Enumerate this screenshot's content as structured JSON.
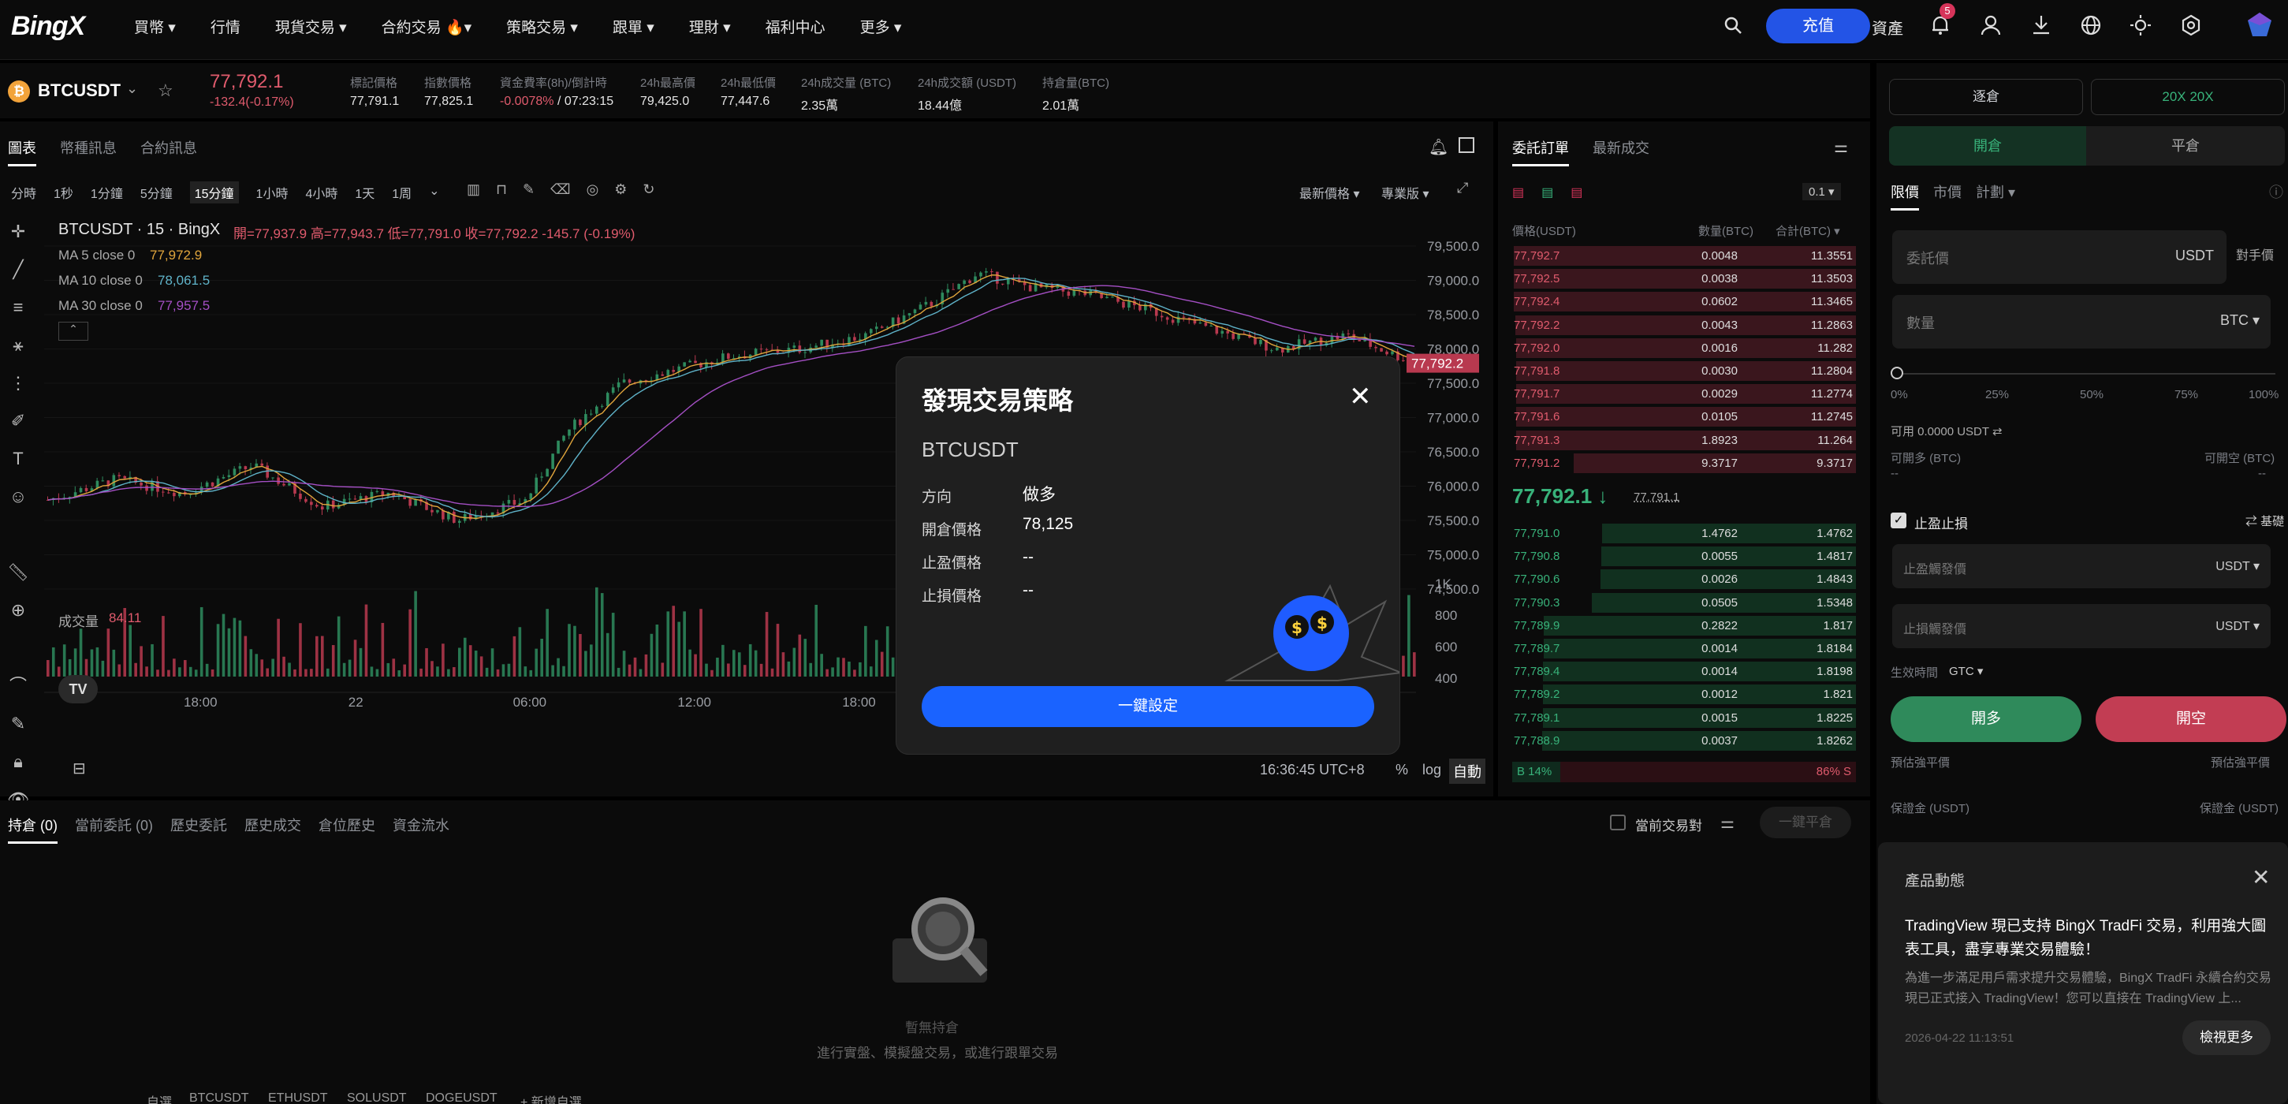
{
  "nav": {
    "logo": "BingX",
    "items": [
      "買幣 ▾",
      "行情",
      "現貨交易 ▾",
      "合約交易 🔥▾",
      "策略交易 ▾",
      "跟單 ▾",
      "理財 ▾",
      "福利中心",
      "更多 ▾"
    ],
    "deposit": "充值",
    "assets": "資產",
    "badge": "5"
  },
  "ticker": {
    "symbol": "BTCUSDT",
    "price": "77,792.1",
    "change": "-132.4(-0.17%)",
    "stats": [
      {
        "label": "標記價格",
        "value": "77,791.1"
      },
      {
        "label": "指數價格",
        "value": "77,825.1"
      },
      {
        "label": "資金費率(8h)/倒計時",
        "value": "-0.0078%",
        "value2": " / 07:23:15"
      },
      {
        "label": "24h最高價",
        "value": "79,425.0"
      },
      {
        "label": "24h最低價",
        "value": "77,447.6"
      },
      {
        "label": "24h成交量 (BTC)",
        "value": "2.35萬"
      },
      {
        "label": "24h成交額 (USDT)",
        "value": "18.44億"
      },
      {
        "label": "持倉量(BTC)",
        "value": "2.01萬"
      }
    ]
  },
  "chart_tabs": [
    "圖表",
    "幣種訊息",
    "合約訊息"
  ],
  "timeframes": [
    "分時",
    "1秒",
    "1分鐘",
    "5分鐘",
    "15分鐘",
    "1小時",
    "4小時",
    "1天",
    "1周"
  ],
  "chart_opts": {
    "price_type": "最新價格 ▾",
    "mode": "專業版 ▾"
  },
  "chart": {
    "title": "BTCUSDT · 15 · BingX",
    "ohlc": "開=77,937.9 高=77,943.7 低=77,791.0 收=77,792.2 -145.7 (-0.19%)",
    "ma": [
      {
        "label": "MA 5 close 0",
        "value": "77,972.9",
        "color": "#e0a53c"
      },
      {
        "label": "MA 10 close 0",
        "value": "78,061.5",
        "color": "#5fb3c9"
      },
      {
        "label": "MA 30 close 0",
        "value": "77,957.5",
        "color": "#a44fc4"
      }
    ],
    "volume_label": "成交量",
    "volume_value": "84.11",
    "yticks": [
      "79,500.0",
      "79,000.0",
      "78,500.0",
      "78,000.0",
      "77,500.0",
      "77,000.0",
      "76,500.0",
      "76,000.0",
      "75,500.0",
      "75,000.0",
      "74,500.0"
    ],
    "last_price_tag": "77,792.2",
    "vol_ticks": [
      "1K",
      "800",
      "600",
      "400"
    ],
    "xticks": [
      "18:00",
      "22",
      "06:00",
      "12:00",
      "18:00"
    ],
    "time": "16:36:45 UTC+8",
    "opts": [
      "%",
      "log",
      "自動"
    ]
  },
  "orderbook": {
    "tabs": [
      "委託訂單",
      "最新成交"
    ],
    "depth": "0.1 ▾",
    "headers": [
      "價格(USDT)",
      "數量(BTC)",
      "合計(BTC) ▾"
    ],
    "asks": [
      [
        "77,792.7",
        "0.0048",
        "11.3551"
      ],
      [
        "77,792.5",
        "0.0038",
        "11.3503"
      ],
      [
        "77,792.4",
        "0.0602",
        "11.3465"
      ],
      [
        "77,792.2",
        "0.0043",
        "11.2863"
      ],
      [
        "77,792.0",
        "0.0016",
        "11.282"
      ],
      [
        "77,791.8",
        "0.0030",
        "11.2804"
      ],
      [
        "77,791.7",
        "0.0029",
        "11.2774"
      ],
      [
        "77,791.6",
        "0.0105",
        "11.2745"
      ],
      [
        "77,791.3",
        "1.8923",
        "11.264"
      ],
      [
        "77,791.2",
        "9.3717",
        "9.3717"
      ]
    ],
    "mid": "77,792.1 ↓",
    "mark": "77,791.1",
    "bids": [
      [
        "77,791.0",
        "1.4762",
        "1.4762"
      ],
      [
        "77,790.8",
        "0.0055",
        "1.4817"
      ],
      [
        "77,790.6",
        "0.0026",
        "1.4843"
      ],
      [
        "77,790.3",
        "0.0505",
        "1.5348"
      ],
      [
        "77,789.9",
        "0.2822",
        "1.817"
      ],
      [
        "77,789.7",
        "0.0014",
        "1.8184"
      ],
      [
        "77,789.4",
        "0.0014",
        "1.8198"
      ],
      [
        "77,789.2",
        "0.0012",
        "1.821"
      ],
      [
        "77,789.1",
        "0.0015",
        "1.8225"
      ],
      [
        "77,788.9",
        "0.0037",
        "1.8262"
      ]
    ],
    "ratio_b": "B 14%",
    "ratio_s": "86% S"
  },
  "modal": {
    "title": "發現交易策略",
    "symbol": "BTCUSDT",
    "rows": [
      {
        "label": "方向",
        "value": "做多"
      },
      {
        "label": "開倉價格",
        "value": "78,125"
      },
      {
        "label": "止盈價格",
        "value": "--"
      },
      {
        "label": "止損價格",
        "value": "--"
      }
    ],
    "button": "一鍵設定"
  },
  "trade": {
    "margin_mode": "逐倉",
    "leverage": "20X  20X",
    "open": "開倉",
    "close": "平倉",
    "order_types": [
      "限價",
      "市價",
      "計劃 ▾"
    ],
    "price_placeholder": "委託價",
    "price_unit": "USDT",
    "counter": "對手價",
    "qty_placeholder": "數量",
    "qty_unit": "BTC ▾",
    "slider": [
      "0%",
      "25%",
      "50%",
      "75%",
      "100%"
    ],
    "avail": "可用 0.0000 USDT ⇄",
    "can_long": "可開多 (BTC)",
    "can_short": "可開空 (BTC)",
    "tpsl": "止盈止損",
    "tpsl_mode": "⇄ 基礎",
    "tp_placeholder": "止盈觸發價",
    "sl_placeholder": "止損觸發價",
    "unit": "USDT ▾",
    "tif_label": "生效時間",
    "tif": "GTC ▾",
    "long": "開多",
    "short": "開空",
    "est_liq": "預估強平價",
    "margin": "保證金 (USDT)",
    "dash": "--"
  },
  "bottom": {
    "tabs": [
      "持倉 (0)",
      "當前委託 (0)",
      "歷史委託",
      "歷史成交",
      "倉位歷史",
      "資金流水"
    ],
    "current_pair": "當前交易對",
    "close_all": "一鍵平倉",
    "empty": "暫無持倉",
    "hint": "進行實盤、模擬盤交易，或進行跟單交易"
  },
  "notice": {
    "title": "產品動態",
    "heading": "TradingView 現已支持 BingX TradFi 交易，利用強大圖表工具，盡享專業交易體驗！",
    "body": "為進一步滿足用戶需求提升交易體驗，BingX TradFi 永續合約交易現已正式接入 TradingView！您可以直接在 TradingView 上...",
    "date": "2026-04-22 11:13:51",
    "more": "檢視更多"
  },
  "footer": {
    "items": [
      "自選",
      "BTCUSDT",
      "ETHUSDT",
      "SOLUSDT",
      "DOGEUSDT",
      "+ 新增自選"
    ]
  }
}
